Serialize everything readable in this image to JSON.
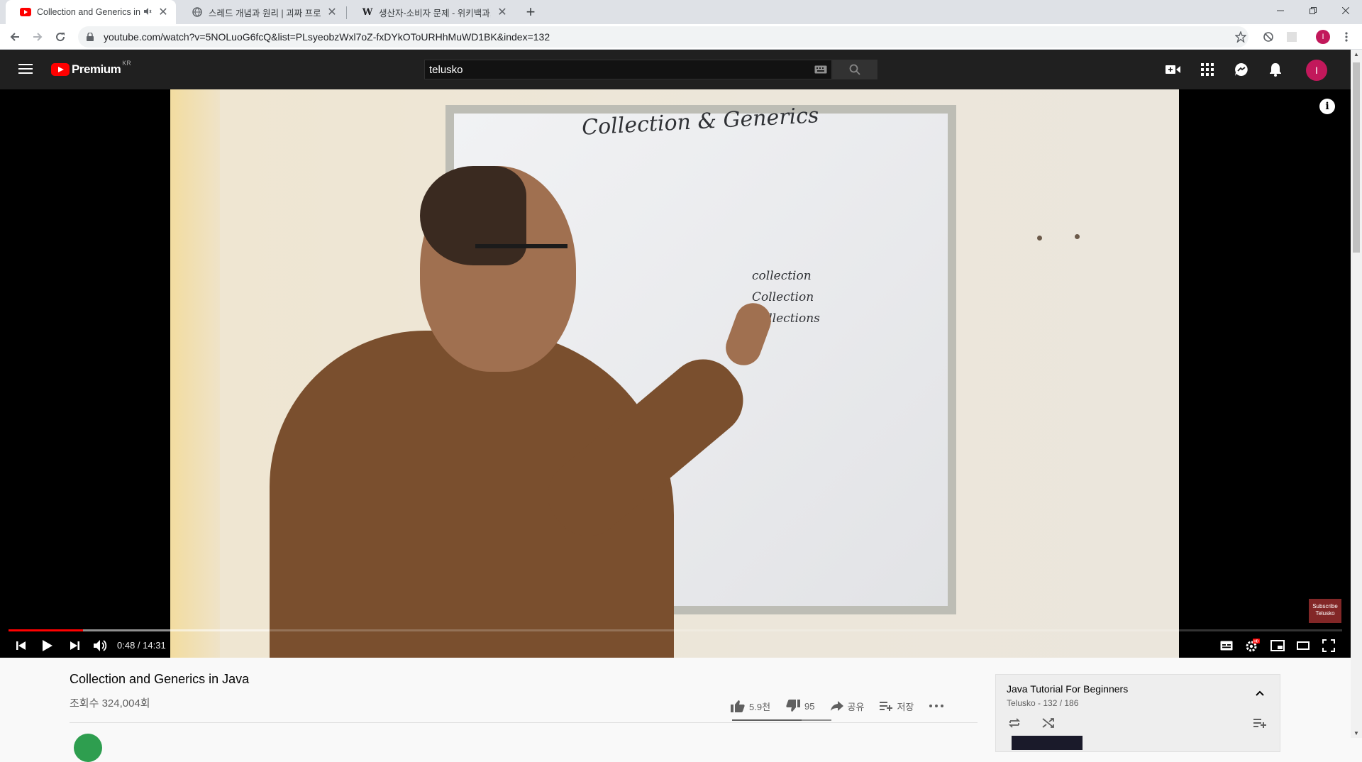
{
  "browser": {
    "tabs": [
      {
        "title": "Collection and Generics in Java",
        "favicon": "youtube-icon"
      },
      {
        "title": "스레드 개념과 원리 | 괴짜 프로그래머",
        "favicon": "globe-icon"
      },
      {
        "title": "생산자-소비자 문제 - 위키백과,",
        "favicon": "wikipedia-icon"
      }
    ],
    "url": "youtube.com/watch?v=5NOLuoG6fcQ&list=PLsyeobzWxl7oZ-fxDYkOToURHhMuWD1BK&index=132",
    "profile_initial": "I"
  },
  "youtube": {
    "logo_text": "Premium",
    "logo_region": "KR",
    "search_query": "telusko",
    "avatar_initial": "I"
  },
  "player": {
    "current_time": "0:48",
    "duration": "14:31",
    "time_separator": " / ",
    "played_fraction": 0.056,
    "buffered_fraction": 0.195,
    "board_title": "Collection & Generics",
    "board_words": [
      "collection",
      "Collection",
      "Collections"
    ],
    "watermark": "Subscribe Telusko"
  },
  "video": {
    "title": "Collection and Generics in Java",
    "views": "조회수 324,004회",
    "likes": "5.9천",
    "dislikes": "95",
    "share_label": "공유",
    "save_label": "저장"
  },
  "playlist": {
    "title": "Java Tutorial For Beginners",
    "subtitle": "Telusko - 132 / 186"
  },
  "colors": {
    "youtube_red": "#ff0000",
    "masthead_bg": "#202020",
    "avatar": "#c2185b"
  }
}
